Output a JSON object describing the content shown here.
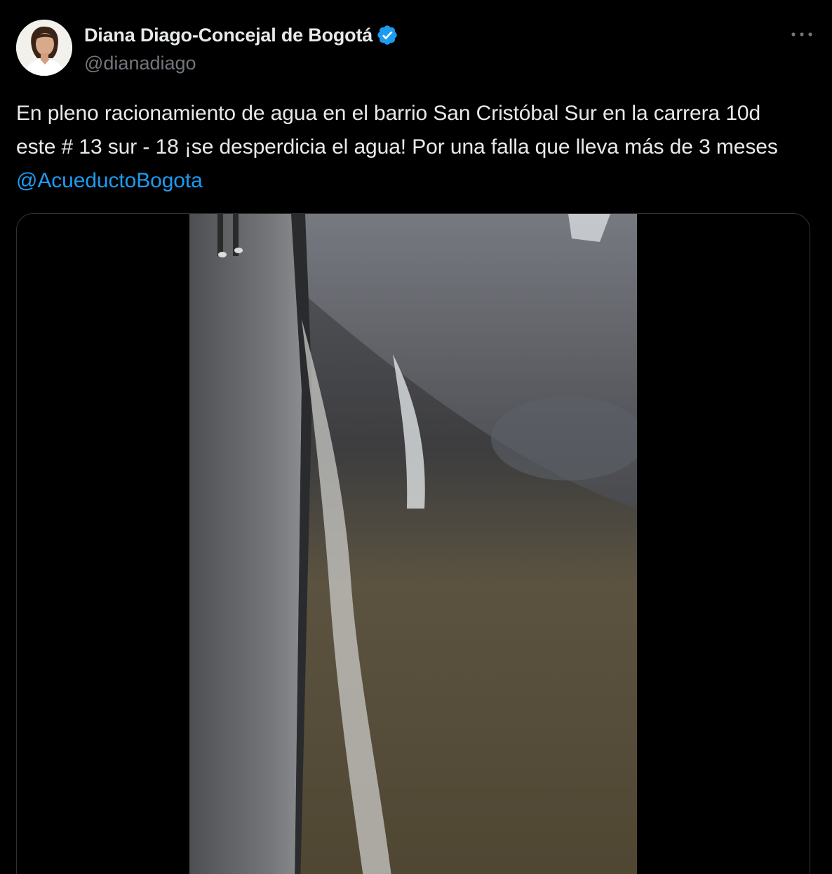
{
  "tweet": {
    "display_name": "Diana Diago-Concejal de Bogotá",
    "handle": "@dianadiago",
    "verified_icon": "verified-badge-icon",
    "more_icon": "more-options-icon",
    "text": "En pleno racionamiento de agua en el barrio San Cristóbal Sur en la carrera 10d este # 13 sur - 18 ¡se desperdicia el agua! Por una falla que lleva más de 3 meses ",
    "mention": "@AcueductoBogota",
    "media_type": "video"
  },
  "colors": {
    "background": "#000000",
    "text": "#e7e9ea",
    "secondary_text": "#71767b",
    "accent": "#1d9bf0",
    "border": "#2f3336"
  }
}
